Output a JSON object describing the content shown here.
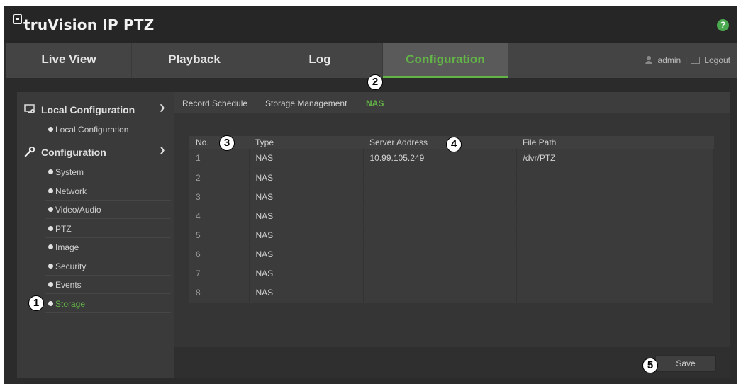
{
  "header": {
    "brand": "truVision IP PTZ",
    "help_label": "?"
  },
  "nav": {
    "tabs": [
      {
        "label": "Live View"
      },
      {
        "label": "Playback"
      },
      {
        "label": "Log"
      },
      {
        "label": "Configuration",
        "active": true
      }
    ],
    "user": "admin",
    "logout": "Logout"
  },
  "sidebar": {
    "local_section": "Local Configuration",
    "local_items": [
      "Local Configuration"
    ],
    "config_section": "Configuration",
    "config_items": [
      "System",
      "Network",
      "Video/Audio",
      "PTZ",
      "Image",
      "Security",
      "Events",
      "Storage"
    ],
    "active_item": "Storage"
  },
  "main": {
    "subtabs": [
      "Record Schedule",
      "Storage Management",
      "NAS"
    ],
    "active_subtab": "NAS",
    "columns": [
      "No.",
      "Type",
      "Server Address",
      "File Path"
    ],
    "rows": [
      [
        "1",
        "NAS",
        "10.99.105.249",
        "/dvr/PTZ"
      ],
      [
        "2",
        "NAS",
        "",
        ""
      ],
      [
        "3",
        "NAS",
        "",
        ""
      ],
      [
        "4",
        "NAS",
        "",
        ""
      ],
      [
        "5",
        "NAS",
        "",
        ""
      ],
      [
        "6",
        "NAS",
        "",
        ""
      ],
      [
        "7",
        "NAS",
        "",
        ""
      ],
      [
        "8",
        "NAS",
        "",
        ""
      ]
    ],
    "save_label": "Save"
  },
  "callouts": [
    "1",
    "2",
    "3",
    "4",
    "5"
  ],
  "colors": {
    "accent": "#63b447",
    "background": "#2b2b2b",
    "panel": "#353535"
  },
  "icons": {
    "local_section": "monitor-gear-icon",
    "config_section": "wrench-icon"
  }
}
